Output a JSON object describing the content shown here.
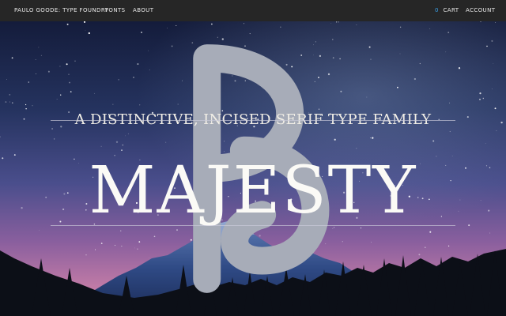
{
  "header": {
    "brand": "PAULO GOODE: TYPE FOUNDRY",
    "fonts": "FONTS",
    "about": "ABOUT",
    "cart_count": "0",
    "cart": "CART",
    "account": "ACCOUNT"
  },
  "hero": {
    "tagline": "A DISTINCTIVE, INCISED SERIF TYPE FAMILY",
    "title": "MAJESTY"
  },
  "colors": {
    "topbar": "#262626",
    "accent": "#3aa0e6",
    "sky_top": "#1d2a55",
    "sky_horizon": "#b36aa6"
  },
  "icons": {
    "monogram": "pg-monogram-icon"
  }
}
